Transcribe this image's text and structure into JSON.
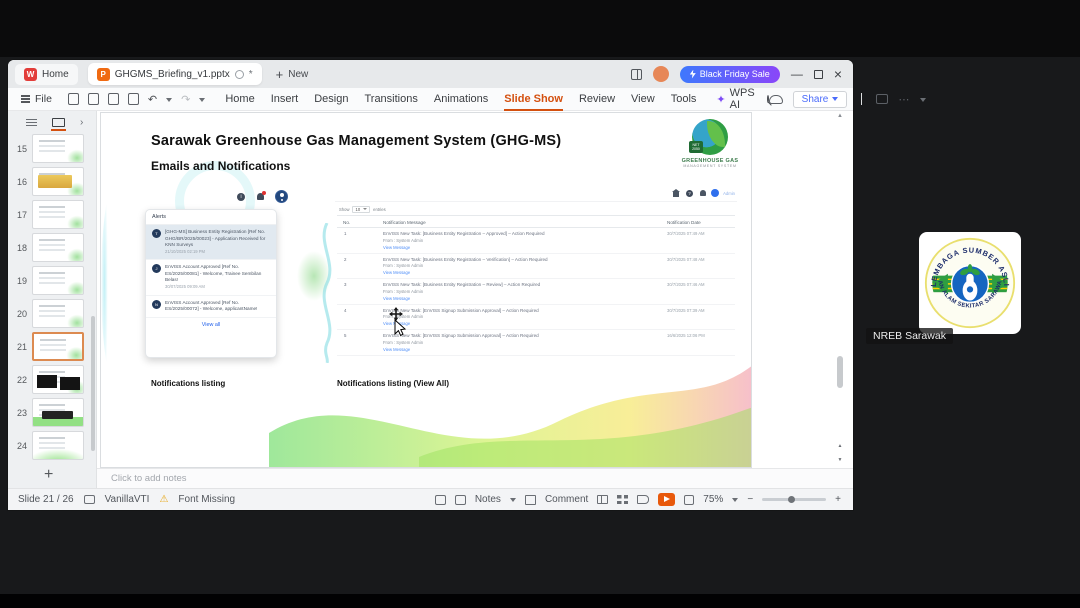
{
  "titlebar": {
    "home_tab": "Home",
    "doc_tab": "GHGMS_Briefing_v1.pptx",
    "new_label": "New",
    "promo_label": "Black Friday Sale"
  },
  "toolbar": {
    "file_label": "File",
    "menus": [
      "Home",
      "Insert",
      "Design",
      "Transitions",
      "Animations",
      "Slide Show",
      "Review",
      "View",
      "Tools"
    ],
    "active_menu": "Slide Show",
    "wps_ai_label": "WPS AI",
    "share_label": "Share"
  },
  "panel": {
    "selected": 21,
    "slides": [
      {
        "n": 15,
        "variant": "lines"
      },
      {
        "n": 16,
        "variant": "gold"
      },
      {
        "n": 17,
        "variant": "lines"
      },
      {
        "n": 18,
        "variant": "lines"
      },
      {
        "n": 19,
        "variant": "lines"
      },
      {
        "n": 20,
        "variant": "lines"
      },
      {
        "n": 21,
        "variant": "lines"
      },
      {
        "n": 22,
        "variant": "dark"
      },
      {
        "n": 23,
        "variant": "greenband"
      },
      {
        "n": 24,
        "variant": "greenwave"
      }
    ]
  },
  "slide": {
    "title": "Sarawak Greenhouse Gas Management System (GHG-MS)",
    "subtitle": "Emails and Notifications",
    "logo": {
      "line1": "GREENHOUSE GAS",
      "line2": "MANAGEMENT SYSTEM",
      "badge_line1": "NET",
      "badge_line2": "2050"
    },
    "alerts": {
      "header": "Alerts",
      "view_all": "View all",
      "items": [
        {
          "initial": "T",
          "text": "[GHG-MS] Business Entity Registration [Ref No. GHG/BR/2025/00023] - Application Received for KNN Surveys",
          "time": "21/10/2025 02:19 PM",
          "highlight": true
        },
        {
          "initial": "J",
          "text": "EnVISS Account Approved [Ref No. ES/2025/00081] - Welcome, Trainee Sembilan Belas!",
          "time": "30/07/2025 09:09 AM",
          "highlight": false
        },
        {
          "initial": "N",
          "text": "EnVISS Account Approved [Ref No. ES/2025/00072] - Welcome, applicantName!",
          "time": "",
          "highlight": false
        }
      ]
    },
    "portal": {
      "user_label": "Admin",
      "show_label": "Show",
      "page_size": "10",
      "entries_label": "entries",
      "headers": {
        "no": "No.",
        "message": "Notification Message",
        "date": "Notification Date"
      },
      "from_line": "From : System Admin",
      "view_message": "View Message",
      "rows": [
        {
          "no": "1",
          "message": "EnVISS New Task: [Business Entity Registration – Approved] – Action Required",
          "date": "30/7/2025 07:49 AM"
        },
        {
          "no": "2",
          "message": "EnVISS New Task: [Business Entity Registration – Verification] – Action Required",
          "date": "30/7/2025 07:48 AM"
        },
        {
          "no": "3",
          "message": "EnVISS New Task: [Business Entity Registration – Review] – Action Required",
          "date": "30/7/2025 07:46 AM"
        },
        {
          "no": "4",
          "message": "EnVISS New Task: [EnVISS Signup Submission Approval] – Action Required",
          "date": "30/7/2025 07:39 AM"
        },
        {
          "no": "5",
          "message": "EnVISS New Task: [EnVISS Signup Submission Approval] – Action Required",
          "date": "16/6/2025 12:06 PM"
        }
      ]
    },
    "caption_left": "Notifications listing",
    "caption_right": "Notifications listing (View All)"
  },
  "notes_placeholder": "Click to add notes",
  "statusbar": {
    "slide_indicator": "Slide 21 / 26",
    "theme_name": "VanillaVTI",
    "font_warning": "Font Missing",
    "notes_label": "Notes",
    "comment_label": "Comment",
    "zoom_level": "75%"
  },
  "meeting": {
    "participant_label": "NREB Sarawak",
    "logo_arc_top": "LEMBAGA SUMBER ASLI",
    "logo_arc_bottom": "DAN ALAM SEKITAR SARAWAK"
  },
  "icons": {
    "close_glyph": "×",
    "minimize_glyph": "—",
    "more_glyph": "⋯",
    "chevron_right_glyph": "›",
    "chevron_down_glyph": "⌄",
    "undo_glyph": "↶",
    "redo_glyph": "↷",
    "warning_glyph": "⚠",
    "sparkle_glyph": "✦",
    "plus_glyph": "+",
    "minus_glyph": "−",
    "asterisk_glyph": "*",
    "up_glyph": "▲",
    "prev_slide_glyph": "▲",
    "next_slide_glyph": "▼",
    "info_glyph": "i",
    "question_glyph": "?"
  }
}
